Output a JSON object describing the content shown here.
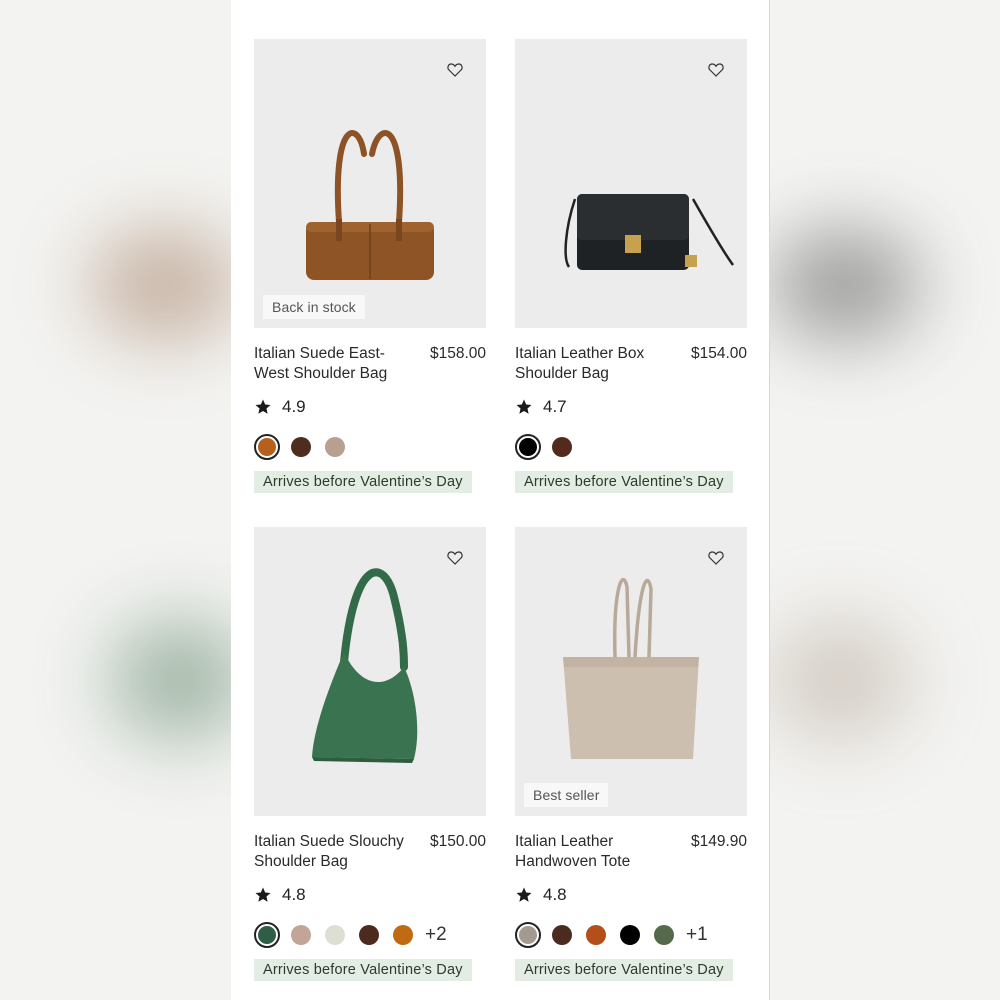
{
  "products": [
    {
      "name": "Italian Suede East-West Shoulder Bag",
      "price": "$158.00",
      "rating": "4.9",
      "badge": "Back in stock",
      "shipping": "Arrives before Valentine’s Day",
      "swatches": [
        "#b5601c",
        "#4e2c1f",
        "#b89f92"
      ],
      "extra_colors": ""
    },
    {
      "name": "Italian Leather Box Shoulder Bag",
      "price": "$154.00",
      "rating": "4.7",
      "badge": "",
      "shipping": "Arrives before Valentine’s Day",
      "swatches": [
        "#000000",
        "#532a1c"
      ],
      "extra_colors": ""
    },
    {
      "name": "Italian Suede Slouchy Shoulder Bag",
      "price": "$150.00",
      "rating": "4.8",
      "badge": "",
      "shipping": "Arrives before Valentine’s Day",
      "swatches": [
        "#2f5d45",
        "#c2a596",
        "#dedfd3",
        "#4d2a1e",
        "#c16a14"
      ],
      "extra_colors": "+2"
    },
    {
      "name": "Italian Leather Handwoven Tote",
      "price": "$149.90",
      "rating": "4.8",
      "badge": "Best seller",
      "shipping": "Arrives before Valentine’s Day",
      "swatches": [
        "#a39b91",
        "#4b2a1f",
        "#b44f1c",
        "#000000",
        "#56694a"
      ],
      "extra_colors": "+1"
    }
  ],
  "icons": {
    "wishlist": "heart-outline-icon",
    "rating": "star-icon"
  },
  "colors": {
    "ship_bg": "#e3ede3",
    "image_bg": "#ececec"
  }
}
